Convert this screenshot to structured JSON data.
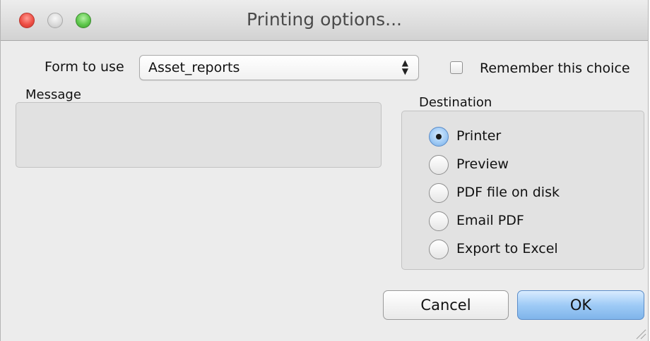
{
  "window": {
    "title": "Printing options...",
    "controls": [
      "close",
      "minimize",
      "zoom"
    ]
  },
  "form": {
    "label": "Form to use",
    "selected": "Asset_reports",
    "remember_label": "Remember this choice",
    "remember_checked": false
  },
  "message": {
    "label": "Message",
    "text": ""
  },
  "destination": {
    "label": "Destination",
    "selected": "Printer",
    "options": [
      "Printer",
      "Preview",
      "PDF file on disk",
      "Email PDF",
      "Export to Excel"
    ]
  },
  "buttons": {
    "cancel": "Cancel",
    "ok": "OK"
  },
  "colors": {
    "close": "#ee4f45",
    "zoom": "#5fc84d",
    "default_button": "#9fcbf6"
  }
}
